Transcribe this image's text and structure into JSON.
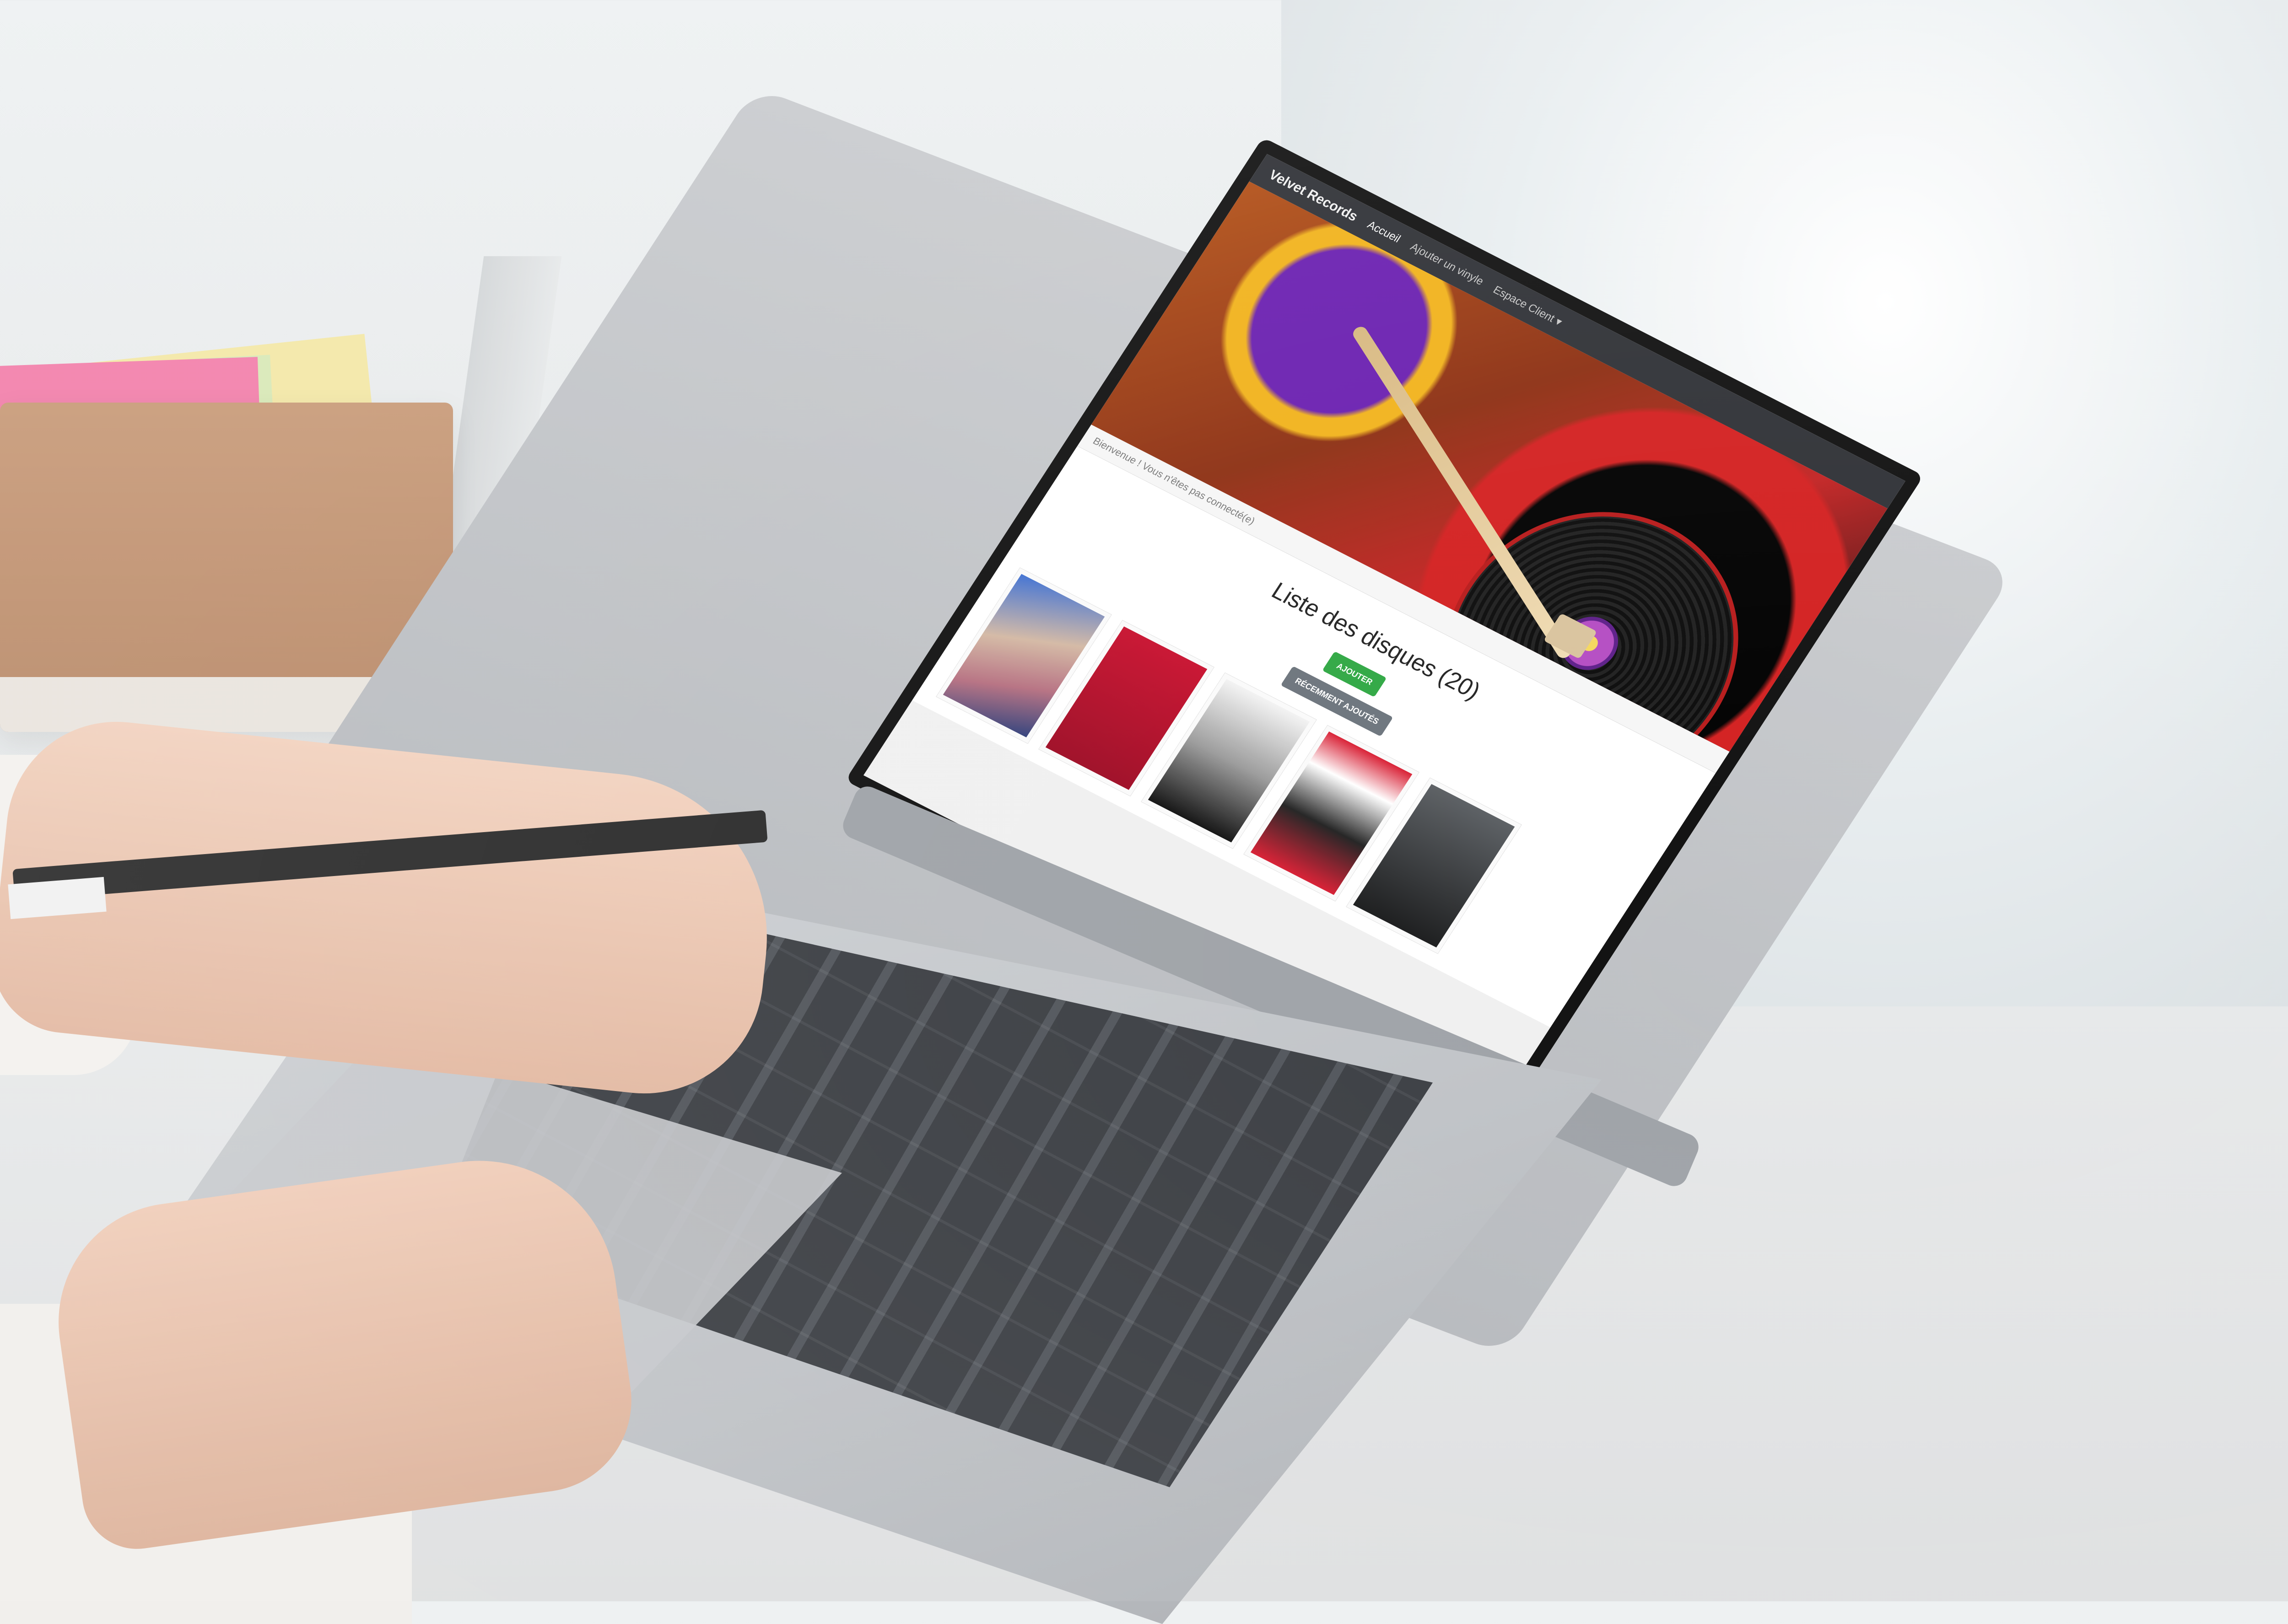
{
  "app": {
    "brand": "Velvet Records",
    "nav": [
      "Accueil",
      "Ajouter un vinyle",
      "Espace Client ▾"
    ],
    "welcome_text": "Bienvenue ! Vous n'êtes pas connecté(e)",
    "page_title": "Liste des disques (20)",
    "buttons": {
      "add": "AJOUTER",
      "recent": "RÉCEMMENT AJOUTÉS"
    },
    "covers": [
      "cover-1",
      "cover-2",
      "cover-3",
      "cover-4",
      "cover-5"
    ]
  }
}
